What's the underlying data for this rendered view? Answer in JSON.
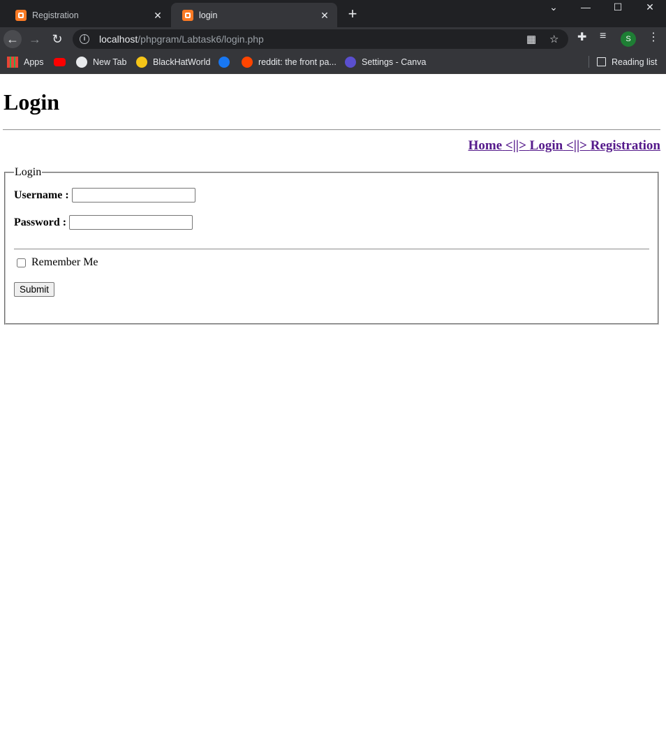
{
  "browser": {
    "tabs": [
      {
        "title": "Registration",
        "active": false
      },
      {
        "title": "login",
        "active": true
      }
    ],
    "address": {
      "host": "localhost",
      "path": "/phpgram/Labtask6/login.php"
    },
    "bookmarks": [
      {
        "label": "Apps",
        "icon": "apps-grid-icon"
      },
      {
        "label": "",
        "icon": "youtube-icon"
      },
      {
        "label": "New Tab",
        "icon": "globe-icon"
      },
      {
        "label": "BlackHatWorld",
        "icon": "blackhatworld-icon"
      },
      {
        "label": "",
        "icon": "facebook-icon"
      },
      {
        "label": "reddit: the front pa...",
        "icon": "reddit-icon"
      },
      {
        "label": "Settings - Canva",
        "icon": "canva-icon"
      }
    ],
    "reading_list": "Reading list",
    "avatar_letter": "S"
  },
  "page": {
    "heading": "Login",
    "nav": {
      "home": "Home",
      "sep": "<||>",
      "login": "Login",
      "registration": "Registration"
    },
    "form": {
      "legend": "Login",
      "username_label": "Username :",
      "username_value": "",
      "password_label": "Password :",
      "password_value": "",
      "remember_label": "Remember Me",
      "submit_label": "Submit"
    }
  }
}
